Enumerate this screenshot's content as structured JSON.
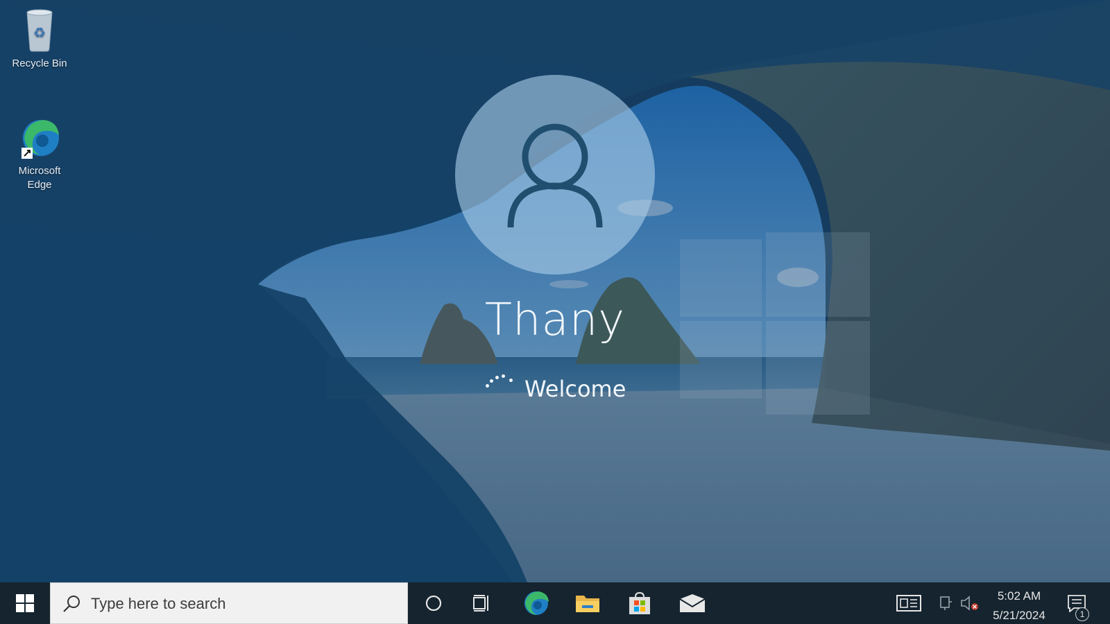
{
  "desktop": {
    "icons": [
      {
        "label": "Recycle Bin",
        "icon": "recycle-bin-icon"
      },
      {
        "label": "Microsoft Edge",
        "icon": "edge-icon"
      }
    ]
  },
  "welcome": {
    "user_name": "Thany",
    "status": "Welcome",
    "avatar_icon": "user-avatar-icon"
  },
  "taskbar": {
    "start_icon": "windows-start-icon",
    "search_placeholder": "Type here to search",
    "search_icon": "search-icon",
    "pinned": [
      {
        "name": "Cortana",
        "icon": "cortana-icon"
      },
      {
        "name": "Task View",
        "icon": "task-view-icon"
      },
      {
        "name": "Microsoft Edge",
        "icon": "edge-icon"
      },
      {
        "name": "File Explorer",
        "icon": "file-explorer-icon"
      },
      {
        "name": "Microsoft Store",
        "icon": "store-icon"
      },
      {
        "name": "Mail",
        "icon": "mail-icon"
      }
    ],
    "tray": {
      "news_icon": "news-widget-icon",
      "network_icon": "network-icon",
      "volume_icon": "volume-muted-icon",
      "time": "5:02 AM",
      "date": "5/21/2024",
      "notifications_count": "1",
      "notifications_icon": "action-center-icon"
    }
  },
  "colors": {
    "taskbar_bg": "#15242f",
    "overlay": "#0a3c6e",
    "text_light": "#f2f7fb"
  }
}
